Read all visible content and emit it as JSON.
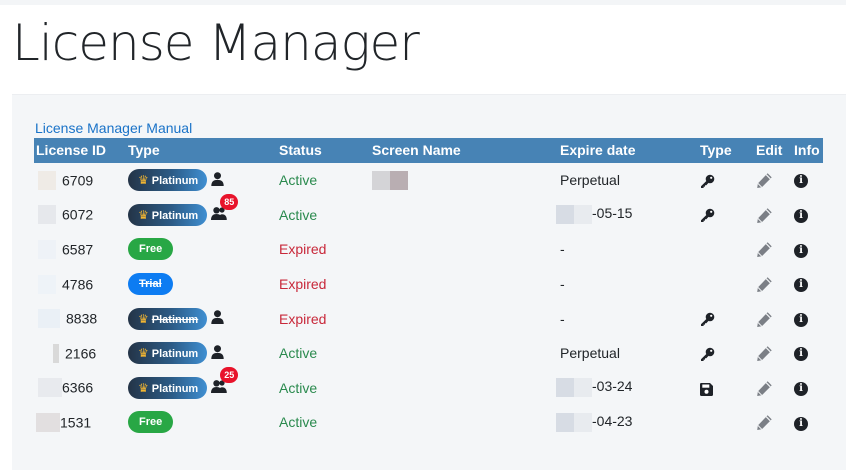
{
  "page": {
    "title": "License Manager"
  },
  "manual_link": "License Manager Manual",
  "columns": [
    "License ID",
    "Type",
    "Status",
    "Screen Name",
    "Expire date",
    "Type",
    "Edit",
    "Info"
  ],
  "rows": [
    {
      "id": "6709",
      "plan": "Platinum",
      "plan_style": "platinum",
      "struck": false,
      "users": "single",
      "count": "",
      "status": "Active",
      "status_kind": "active",
      "screen_name": true,
      "expire": "Perpetual",
      "date_blur": false,
      "type_icon": "key"
    },
    {
      "id": "6072",
      "plan": "Platinum",
      "plan_style": "platinum",
      "struck": false,
      "users": "group",
      "count": "85",
      "status": "Active",
      "status_kind": "active",
      "screen_name": false,
      "expire": "-05-15",
      "date_blur": true,
      "type_icon": "key"
    },
    {
      "id": "6587",
      "plan": "Free",
      "plan_style": "free",
      "struck": false,
      "users": "none",
      "count": "",
      "status": "Expired",
      "status_kind": "expired",
      "screen_name": false,
      "expire": "-",
      "date_blur": false,
      "type_icon": "none"
    },
    {
      "id": "4786",
      "plan": "Trial",
      "plan_style": "trial",
      "struck": true,
      "users": "none",
      "count": "",
      "status": "Expired",
      "status_kind": "expired",
      "screen_name": false,
      "expire": "-",
      "date_blur": false,
      "type_icon": "none"
    },
    {
      "id": "8838",
      "plan": "Platinum",
      "plan_style": "platinum",
      "struck": true,
      "users": "single",
      "count": "",
      "status": "Expired",
      "status_kind": "expired",
      "screen_name": false,
      "expire": "-",
      "date_blur": false,
      "type_icon": "key"
    },
    {
      "id": "2166",
      "plan": "Platinum",
      "plan_style": "platinum",
      "struck": false,
      "users": "single",
      "count": "",
      "status": "Active",
      "status_kind": "active",
      "screen_name": false,
      "expire": "Perpetual",
      "date_blur": false,
      "type_icon": "key"
    },
    {
      "id": "6366",
      "plan": "Platinum",
      "plan_style": "platinum",
      "struck": false,
      "users": "group",
      "count": "25",
      "status": "Active",
      "status_kind": "active",
      "screen_name": false,
      "expire": "-03-24",
      "date_blur": true,
      "type_icon": "floppy"
    },
    {
      "id": "1531",
      "plan": "Free",
      "plan_style": "free",
      "struck": false,
      "users": "none",
      "count": "",
      "status": "Active",
      "status_kind": "active",
      "screen_name": false,
      "expire": "-04-23",
      "date_blur": true,
      "type_icon": "none"
    }
  ],
  "icons": {
    "crown": "crown-icon",
    "user": "user-icon",
    "group": "users-icon",
    "key": "key-icon",
    "floppy": "save-icon",
    "edit": "pencil-icon",
    "info": "info-icon"
  },
  "colors": {
    "header_bg": "#4783b5",
    "active": "#2a8a4e",
    "expired": "#c8283a",
    "free": "#28a745",
    "trial": "#0d7cf2",
    "count_badge": "#e8132b",
    "link": "#1a73c8"
  }
}
